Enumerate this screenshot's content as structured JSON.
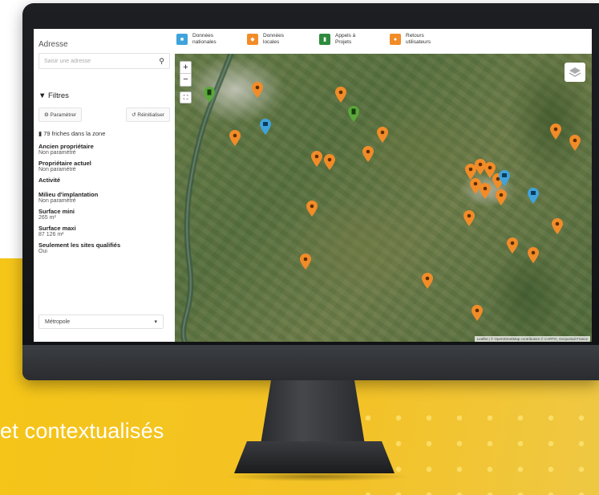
{
  "tagline": "et contextualisés",
  "sidebar": {
    "address_label": "Adresse",
    "search_placeholder": "Saisir une adresse",
    "filters_label": "Filtres",
    "settings_button": "Paramétrer",
    "reset_button": "Réinitialiser",
    "count_text": "79 friches dans la zone",
    "filters": [
      {
        "label": "Ancien propriétaire",
        "value": "Non paramétré"
      },
      {
        "label": "Propriétaire actuel",
        "value": "Non paramétré"
      },
      {
        "label": "Activité",
        "value": ""
      },
      {
        "label": "Milieu d'implantation",
        "value": "Non paramétré"
      },
      {
        "label": "Surface mini",
        "value": "265 m²"
      },
      {
        "label": "Surface maxi",
        "value": "87 126 m²"
      },
      {
        "label": "Seulement les sites qualifiés",
        "value": "Oui"
      }
    ],
    "region_select": "Métropole"
  },
  "legend": [
    {
      "label": "Données nationales",
      "color": "#3fa3dc",
      "icon": "factory-icon"
    },
    {
      "label": "Données locales",
      "color": "#f28c28",
      "icon": "tag-icon"
    },
    {
      "label": "Appels à Projets",
      "color": "#2e8b3d",
      "icon": "document-icon"
    },
    {
      "label": "Retours utilisateurs",
      "color": "#f28c28",
      "icon": "person-icon"
    }
  ],
  "map": {
    "zoom_in": "+",
    "zoom_out": "−",
    "attribution": "Leaflet | © OpenStreetMap contributors © CARTO, Geoportail France"
  },
  "colors": {
    "orange": "#f28c28",
    "blue": "#3fa3dc",
    "green": "#5aa83a",
    "yellow": "#f5c518"
  }
}
